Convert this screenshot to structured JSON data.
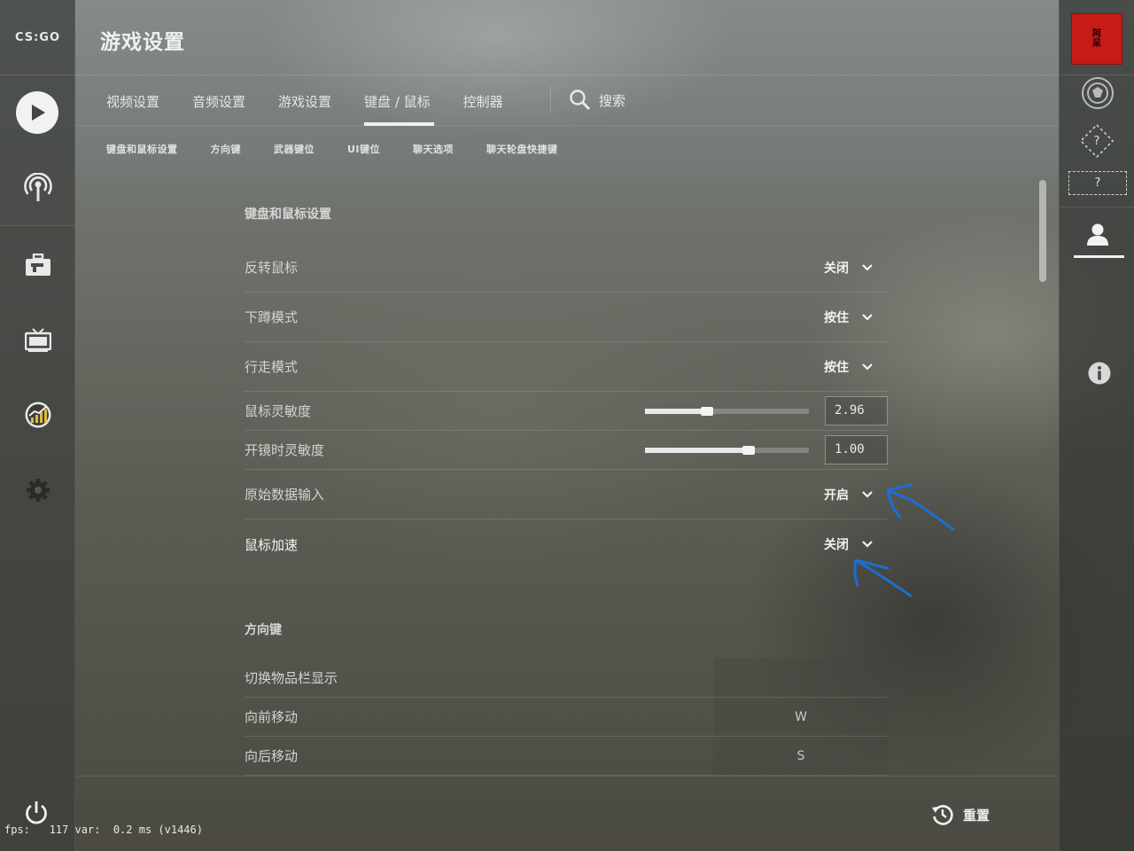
{
  "app": {
    "logo_text": "CS:GO",
    "page_title": "游戏设置"
  },
  "tabs": [
    {
      "label": "视频设置",
      "active": false
    },
    {
      "label": "音频设置",
      "active": false
    },
    {
      "label": "游戏设置",
      "active": false
    },
    {
      "label": "键盘 / 鼠标",
      "active": true
    },
    {
      "label": "控制器",
      "active": false
    }
  ],
  "search_label": "搜索",
  "subtabs": [
    "键盘和鼠标设置",
    "方向键",
    "武器键位",
    "UI键位",
    "聊天选项",
    "聊天轮盘快捷键"
  ],
  "section_keyboard_mouse": {
    "title": "键盘和鼠标设置",
    "rows": {
      "invert_mouse": {
        "label": "反转鼠标",
        "value": "关闭"
      },
      "crouch_mode": {
        "label": "下蹲模式",
        "value": "按住"
      },
      "walk_mode": {
        "label": "行走模式",
        "value": "按住"
      },
      "mouse_sensitivity": {
        "label": "鼠标灵敏度",
        "value": "2.96",
        "slider_fraction": 0.38
      },
      "zoom_sensitivity": {
        "label": "开镜时灵敏度",
        "value": "1.00",
        "slider_fraction": 0.63
      },
      "raw_input": {
        "label": "原始数据输入",
        "value": "开启"
      },
      "mouse_accel": {
        "label": "鼠标加速",
        "value": "关闭"
      }
    }
  },
  "section_movement": {
    "title": "方向键",
    "rows": {
      "toggle_inventory": {
        "label": "切换物品栏显示",
        "key": ""
      },
      "move_forward": {
        "label": "向前移动",
        "key": "W"
      },
      "move_back": {
        "label": "向后移动",
        "key": "S"
      }
    }
  },
  "footer": {
    "reset_label": "重置",
    "fps_text": "fps:   117 var:  0.2 ms (v1446)"
  },
  "right_bar": {
    "avatar_text_1": "阿",
    "avatar_text_2": "呆",
    "unranked_label": "?",
    "wingman_label": "?"
  },
  "colors": {
    "annotation_blue": "#1a6fd6",
    "avatar_red": "#c61b16"
  }
}
